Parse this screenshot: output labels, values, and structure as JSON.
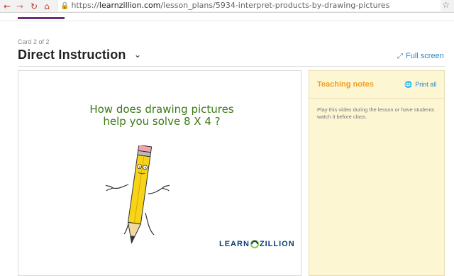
{
  "browser": {
    "back_icon": "back-arrow-icon",
    "forward_icon": "forward-arrow-icon",
    "reload_icon": "reload-icon",
    "home_icon": "home-icon",
    "lock_icon": "lock-icon",
    "url_scheme": "https://",
    "url_host": "learnzillion.com",
    "url_path": "/lesson_plans/5934-interpret-products-by-drawing-pictures",
    "bookmark_icon": "star-icon"
  },
  "card": {
    "label": "Card 2 of 2",
    "title": "Direct Instruction",
    "fullscreen_label": "Full screen"
  },
  "video": {
    "question_line1": "How does drawing pictures",
    "question_line2": "help you solve 8 X 4 ?",
    "brand_left": "LEARN",
    "brand_right": "ZILLION"
  },
  "notes": {
    "title": "Teaching notes",
    "print_label": "Print all",
    "body": "Play this video during the lesson or have students watch it before class."
  },
  "colors": {
    "accent_purple": "#6b2f7a",
    "link_blue": "#2a86c8",
    "notes_bg": "#fdf6d3",
    "notes_title": "#f0a020",
    "question_green": "#3e7a17"
  }
}
